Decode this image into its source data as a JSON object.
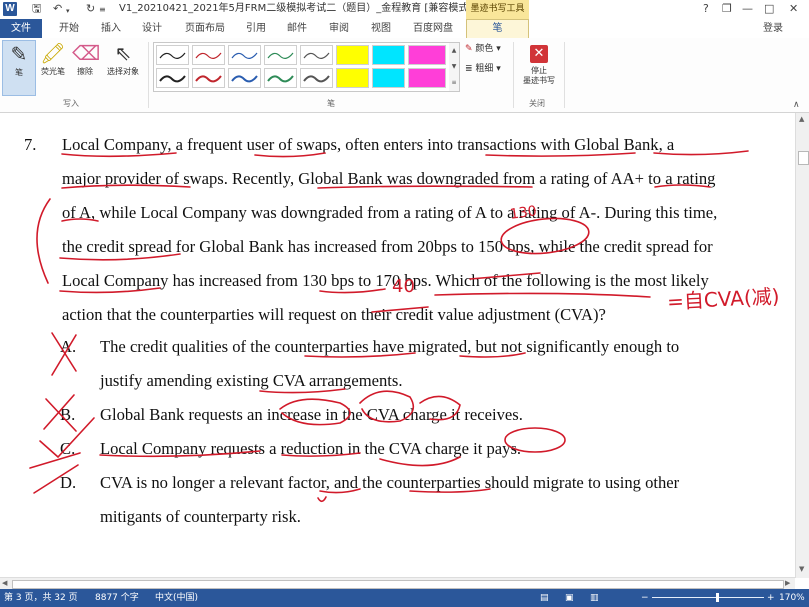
{
  "titlebar": {
    "app_letter": "W",
    "title": "V1_20210421_2021年5月FRM二级模拟考试二（题目）_金程教育 [兼容模式]...",
    "contextual_label": "墨迹书写工具",
    "help": "?",
    "restore": "❐",
    "minimize": "—",
    "maximize": "□",
    "close": "✕"
  },
  "tabs": {
    "file": "文件",
    "items": [
      "开始",
      "插入",
      "设计",
      "页面布局",
      "引用",
      "邮件",
      "审阅",
      "视图",
      "百度网盘"
    ],
    "pen": "笔",
    "login": "登录"
  },
  "ribbon": {
    "tools": [
      "笔",
      "荧光笔",
      "擦除",
      "选择对象"
    ],
    "group_write": "写入",
    "group_pen": "笔",
    "color": "颜色",
    "thickness": "粗细",
    "stop_line1": "停止",
    "stop_line2": "墨迹书写",
    "group_close": "关闭",
    "colors": {
      "pen_black": "#222222",
      "pen_red": "#c0262d",
      "pen_blue": "#2a5db0",
      "pen_green": "#2e8b57",
      "highlight_yellow": "#ffff00",
      "highlight_cyan": "#00e5ff",
      "highlight_magenta": "#ff3ed8"
    }
  },
  "document": {
    "number": "7.",
    "lines": [
      "Local Company, a frequent user of swaps, often enters into transactions with Global Bank, a",
      "major provider of swaps. Recently, Global Bank was downgraded from a rating of AA+ to a rating",
      "of A, while Local Company was downgraded from a rating of A to a rating of A-. During this time,",
      "the credit spread for Global Bank has increased from 20bps to 150 bps, while the credit spread for",
      "Local Company has increased from 130 bps to 170 bps. Which of the following is the most likely",
      "action that the counterparties will request on their credit value adjustment (CVA)?"
    ],
    "options": [
      {
        "letter": "A.",
        "lines": [
          "The credit qualities of the counterparties have migrated, but not significantly enough to",
          "justify amending existing CVA arrangements."
        ]
      },
      {
        "letter": "B.",
        "lines": [
          "Global Bank requests an increase in the CVA charge it receives."
        ]
      },
      {
        "letter": "C.",
        "lines": [
          "Local Company requests a reduction in the CVA charge it pays."
        ]
      },
      {
        "letter": "D.",
        "lines": [
          "CVA is no longer a relevant factor, and the counterparties should migrate to using other",
          "mitigants of counterparty risk."
        ]
      }
    ],
    "handwriting": {
      "above_150": "130",
      "above_170": "40",
      "side_note": "=自CVA(减)",
      "ink_color": "#d11a2a"
    }
  },
  "status": {
    "page": "第 3 页，共 32 页",
    "words": "8877 个字",
    "lang": "中文(中国)",
    "minus": "−",
    "plus": "+",
    "zoom": "170%"
  }
}
